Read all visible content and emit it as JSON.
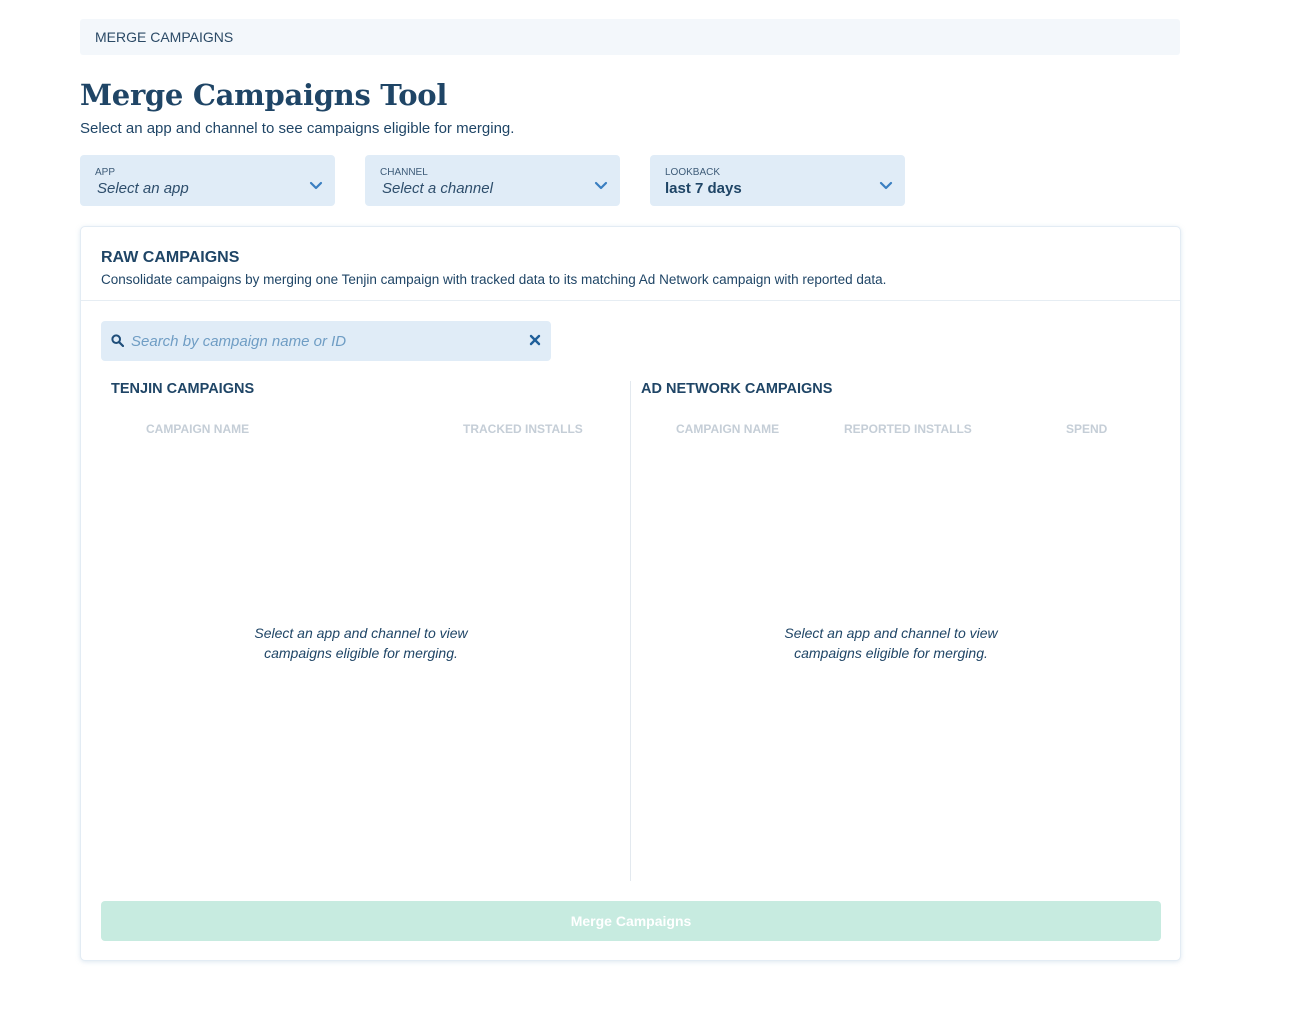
{
  "breadcrumb": "MERGE CAMPAIGNS",
  "title": "Merge Campaigns Tool",
  "subtitle": "Select an app and channel to see campaigns eligible for merging.",
  "filters": {
    "app": {
      "label": "APP",
      "value": "Select an app"
    },
    "channel": {
      "label": "CHANNEL",
      "value": "Select a channel"
    },
    "lookback": {
      "label": "LOOKBACK",
      "value": "last 7 days"
    }
  },
  "raw": {
    "title": "RAW CAMPAIGNS",
    "description": "Consolidate campaigns by merging one Tenjin campaign with tracked data to its matching Ad Network campaign with reported data.",
    "search_placeholder": "Search by campaign name or ID",
    "tenjin": {
      "title": "TENJIN CAMPAIGNS",
      "columns": [
        "CAMPAIGN NAME",
        "TRACKED INSTALLS"
      ],
      "empty_line1": "Select an app and channel to view",
      "empty_line2": "campaigns eligible for merging."
    },
    "adnetwork": {
      "title": "AD NETWORK CAMPAIGNS",
      "columns": [
        "CAMPAIGN NAME",
        "REPORTED INSTALLS",
        "SPEND"
      ],
      "empty_line1": "Select an app and channel to view",
      "empty_line2": "campaigns eligible for merging."
    },
    "merge_button": "Merge Campaigns"
  },
  "colors": {
    "primary_text": "#1f4566",
    "field_bg": "#e0ecf7",
    "accent_blue": "#3a7fc1",
    "merge_disabled": "#c7ebe0"
  },
  "icons": {
    "dropdown": "chevron-down-icon",
    "search": "search-icon",
    "clear": "close-icon"
  }
}
